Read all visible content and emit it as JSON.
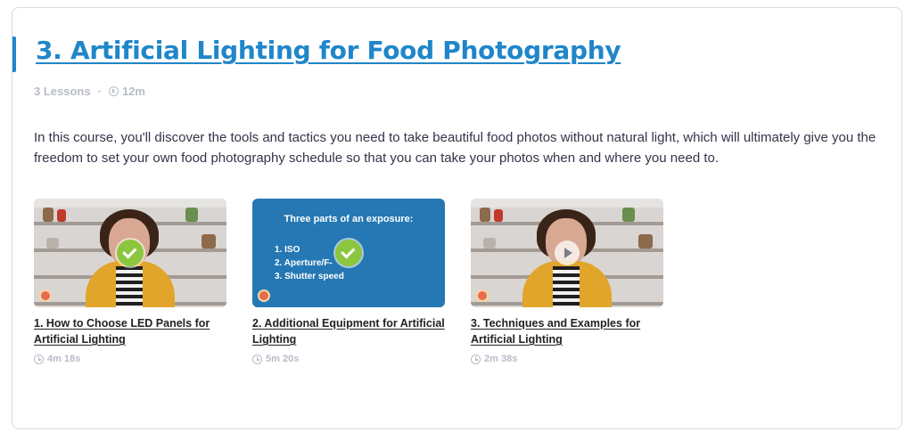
{
  "course": {
    "title": "3. Artificial Lighting for Food Photography",
    "lessons_count": "3 Lessons",
    "separator": "·",
    "total_duration": "12m",
    "description": "In this course, you'll discover the tools and tactics you need to take beautiful food photos without natural light, which will ultimately give you the freedom to set your own food photography schedule so that you can take your photos when and where you need to."
  },
  "lessons": [
    {
      "title": "1. How to Choose LED Panels for Artificial Lighting",
      "duration": "4m 18s",
      "status": "completed",
      "status_icon": "check-icon",
      "thumb_type": "photo"
    },
    {
      "title": "2. Additional Equipment for Artificial Lighting",
      "duration": "5m 20s",
      "status": "completed",
      "status_icon": "check-icon",
      "thumb_type": "slide",
      "slide": {
        "heading": "Three parts of an exposure:",
        "items": [
          "1. ISO",
          "2. Aperture/F-",
          "3. Shutter speed"
        ]
      }
    },
    {
      "title": "3. Techniques and Examples for Artificial Lighting",
      "duration": "2m 38s",
      "status": "not-started",
      "status_icon": "play-icon",
      "thumb_type": "photo"
    }
  ],
  "colors": {
    "accent": "#1f86c9",
    "check": "#8cc63f",
    "muted": "#b7bcc7",
    "slide_bg": "#2578b3",
    "sweater": "#e0a52a"
  }
}
